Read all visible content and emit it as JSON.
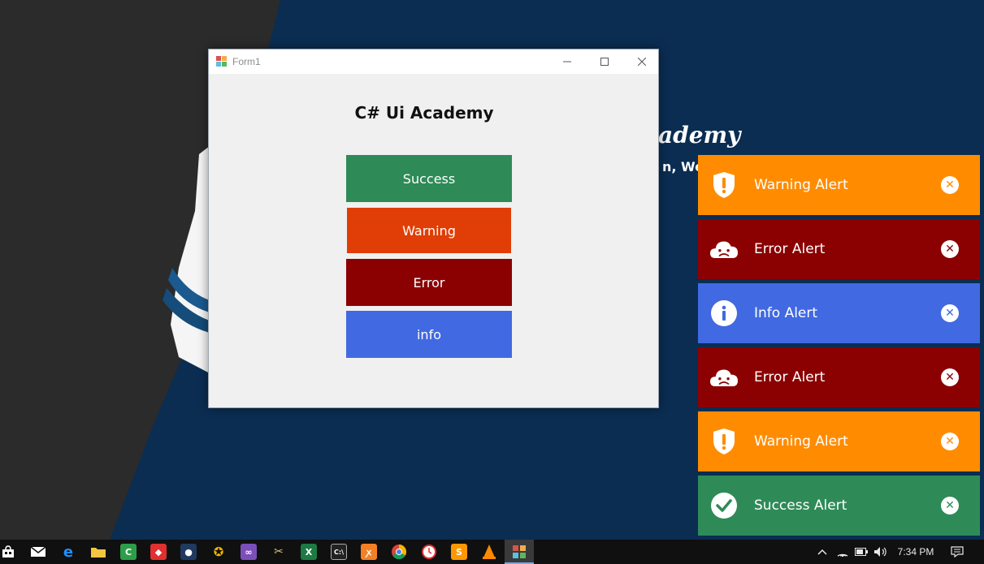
{
  "wallpaper": {
    "title_fragment": "ademy",
    "tagline_fragment": "n, We D"
  },
  "window": {
    "title": "Form1",
    "minimize_icon": "minimize-icon",
    "maximize_icon": "maximize-icon",
    "close_icon": "close-icon"
  },
  "form": {
    "heading": "C# Ui Academy",
    "buttons": {
      "success": "Success",
      "warning": "Warning",
      "error": "Error",
      "info": "info"
    }
  },
  "alerts": [
    {
      "type": "warning",
      "text": "Warning Alert",
      "icon": "shield-exclamation-icon",
      "color": "#ff8c00"
    },
    {
      "type": "error",
      "text": "Error Alert",
      "icon": "sad-cloud-icon",
      "color": "#8b0000"
    },
    {
      "type": "info",
      "text": "Info Alert",
      "icon": "info-icon",
      "color": "#4169e1"
    },
    {
      "type": "error",
      "text": "Error Alert",
      "icon": "sad-cloud-icon",
      "color": "#8b0000"
    },
    {
      "type": "warning",
      "text": "Warning Alert",
      "icon": "shield-exclamation-icon",
      "color": "#ff8c00"
    },
    {
      "type": "success",
      "text": "Success Alert",
      "icon": "checkmark-icon",
      "color": "#2e8b57"
    }
  ],
  "taskbar": {
    "clock": "7:34 PM",
    "apps": [
      "store-icon",
      "mail-icon",
      "edge-icon",
      "file-explorer-icon",
      "camtasia-icon",
      "app-red-icon",
      "app-bird-icon",
      "app-lifebuoy-icon",
      "visual-studio-icon",
      "tools-icon",
      "excel-icon",
      "cmd-icon",
      "xampp-icon",
      "chrome-icon",
      "app-clock-icon",
      "sublime-icon",
      "vlc-icon",
      "form-app-icon"
    ],
    "tray_icons": [
      "chevron-up-icon",
      "wifi-icon",
      "battery-icon",
      "volume-icon",
      "notification-icon"
    ]
  }
}
